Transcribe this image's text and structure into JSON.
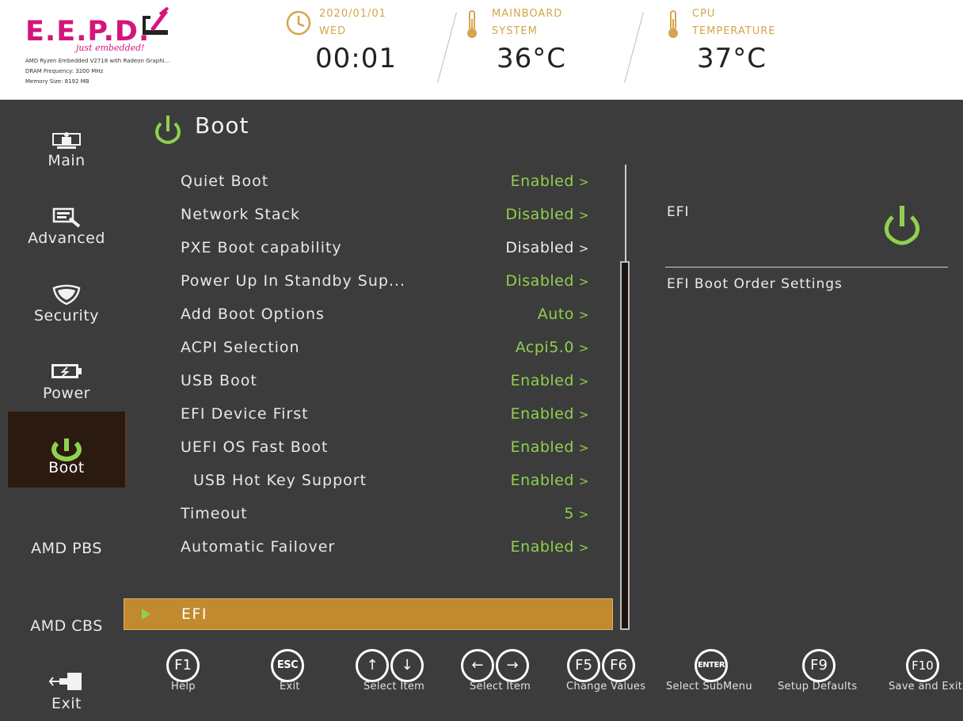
{
  "brand": {
    "logo": "E.E.P.D.",
    "tagline": "just embedded!",
    "sysinfo": [
      "AMD Ryzen Embedded V2718 with Radeon Graphi...",
      "DRAM Frequency: 3200 MHz",
      "Memory Size: 8192 MB"
    ]
  },
  "header": {
    "date": "2020/01/01",
    "weekday": "WED",
    "time": "00:01",
    "mainboard_label_1": "MAINBOARD",
    "mainboard_label_2": "SYSTEM",
    "mainboard_temp": "36°C",
    "cpu_label_1": "CPU",
    "cpu_label_2": "TEMPERATURE",
    "cpu_temp": "37°C"
  },
  "sidebar": {
    "items": [
      {
        "label": "Main",
        "icon": "monitor-icon"
      },
      {
        "label": "Advanced",
        "icon": "advanced-tools-icon"
      },
      {
        "label": "Security",
        "icon": "shield-icon"
      },
      {
        "label": "Power",
        "icon": "battery-icon"
      },
      {
        "label": "Boot",
        "icon": "power-icon",
        "active": true
      },
      {
        "label": "AMD PBS"
      },
      {
        "label": "AMD CBS"
      },
      {
        "label": "Exit",
        "icon": "exit-plug-icon"
      }
    ]
  },
  "page": {
    "title": "Boot",
    "title_icon": "power-icon"
  },
  "settings": [
    {
      "label": "Quiet Boot",
      "value": "Enabled"
    },
    {
      "label": "Network Stack",
      "value": "Disabled"
    },
    {
      "label": "PXE Boot capability",
      "value": "Disabled"
    },
    {
      "label": "Power Up In Standby Sup...",
      "value": "Disabled"
    },
    {
      "label": "Add Boot Options",
      "value": "Auto"
    },
    {
      "label": "ACPI Selection",
      "value": "Acpi5.0"
    },
    {
      "label": "USB Boot",
      "value": "Enabled"
    },
    {
      "label": "EFI Device First",
      "value": "Enabled"
    },
    {
      "label": "UEFI OS Fast Boot",
      "value": "Enabled"
    },
    {
      "label": "USB Hot Key Support",
      "value": "Enabled"
    },
    {
      "label": "Timeout",
      "value": "5"
    },
    {
      "label": "Automatic Failover",
      "value": "Enabled"
    }
  ],
  "selected_submenu": {
    "label": "EFI"
  },
  "help": {
    "title": "EFI",
    "description": "EFI Boot Order Settings"
  },
  "footer": {
    "keys": [
      {
        "caps": [
          "F1"
        ],
        "label": "Help"
      },
      {
        "caps": [
          "ESC"
        ],
        "label": "Exit"
      },
      {
        "caps": [
          "↑",
          "↓"
        ],
        "label": "Select Item"
      },
      {
        "caps": [
          "←",
          "→"
        ],
        "label": "Select Item"
      },
      {
        "caps": [
          "F5",
          "F6"
        ],
        "label": "Change Values"
      },
      {
        "caps": [
          "ENTER"
        ],
        "label": "Select SubMenu"
      },
      {
        "caps": [
          "F9"
        ],
        "label": "Setup Defaults"
      },
      {
        "caps": [
          "F10"
        ],
        "label": "Save and Exit"
      }
    ]
  },
  "colors": {
    "accent_green": "#8fd14f",
    "selection_amber": "#c18a2f",
    "brand_pink": "#d4157a",
    "panel_bg": "#3c3c3c"
  }
}
